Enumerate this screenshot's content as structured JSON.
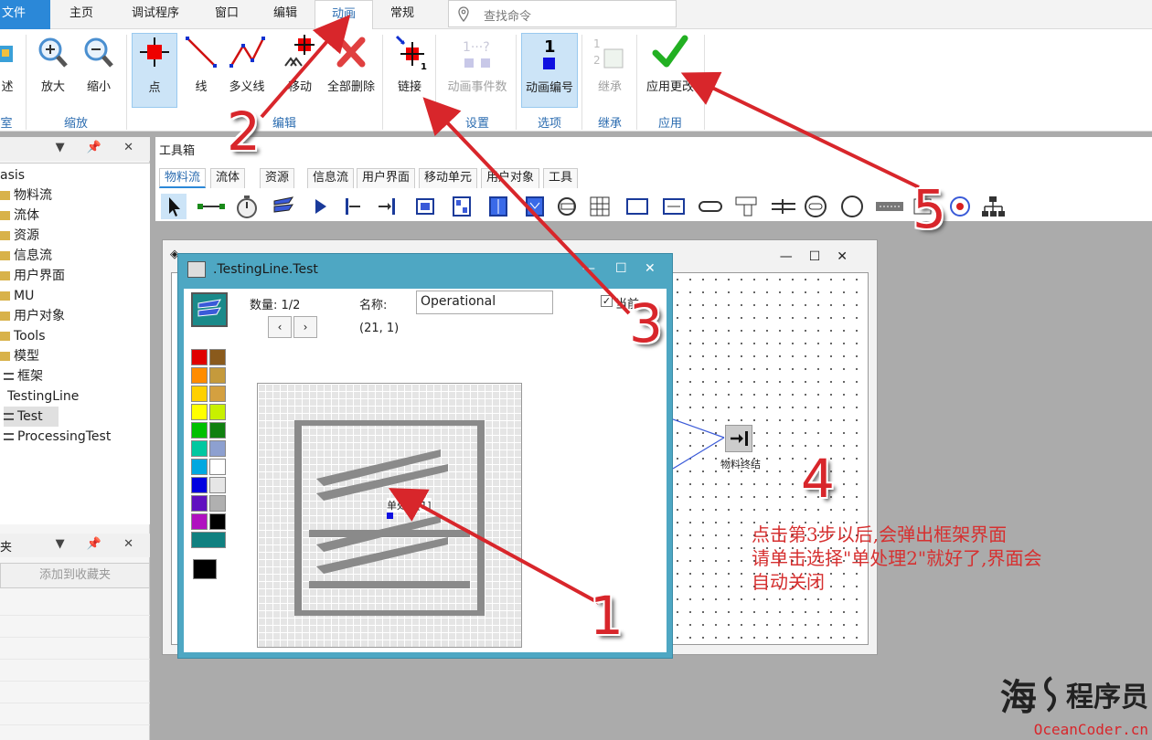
{
  "menubar": {
    "file": "文件",
    "tabs": [
      "主页",
      "调试程序",
      "窗口",
      "编辑",
      "动画",
      "常规"
    ],
    "search_placeholder": "查找命令"
  },
  "ribbon": {
    "partial_label_left": "述",
    "buttons": [
      {
        "label": "放大"
      },
      {
        "label": "缩小"
      },
      {
        "label": "点"
      },
      {
        "label": "线"
      },
      {
        "label": "多义线"
      },
      {
        "label": "移动"
      },
      {
        "label": "全部删除"
      },
      {
        "label": "链接"
      },
      {
        "label": "动画事件数"
      },
      {
        "label": "动画编号"
      },
      {
        "label": "继承"
      },
      {
        "label": "应用更改"
      }
    ],
    "groups": [
      "室",
      "缩放",
      "编辑",
      "设置",
      "选项",
      "继承",
      "应用"
    ]
  },
  "left_panel": {
    "tree": [
      "asis",
      "物料流",
      "流体",
      "资源",
      "信息流",
      "用户界面",
      "MU",
      "用户对象",
      "Tools",
      "模型",
      "框架",
      "TestingLine",
      "Test",
      "ProcessingTest"
    ],
    "fav_title": "夹",
    "fav_add": "添加到收藏夹"
  },
  "toolbox": {
    "title": "工具箱",
    "tabs": [
      "物料流",
      "流体",
      "资源",
      "信息流",
      "用户界面",
      "移动单元",
      "用户对象",
      "工具"
    ]
  },
  "dialog": {
    "title": ".TestingLine.Test",
    "count": "数量: 1/2",
    "name_label": "名称:",
    "name_value": "Operational",
    "coords": "(21, 1)",
    "checkbox_label": "当前",
    "point_label": "单处理[1]",
    "controls": {
      "minimize": "—",
      "maximize": "☐",
      "close": "✕"
    }
  },
  "frame": {
    "node_label": "物料终结"
  },
  "annotations": {
    "numbers": [
      "1",
      "2",
      "3",
      "4",
      "5"
    ],
    "note_lines": [
      "点击第3步以后,会弹出框架界面",
      "请单击选择\"单处理2\"就好了,界面会",
      "自动关闭"
    ]
  },
  "watermark": {
    "brand": "海",
    "brand_text": "程序员",
    "site": "OceanCoder.cn"
  },
  "colors": {
    "accent": "#2b88d8",
    "dialog_frame": "#4ea7c3",
    "annotation_red": "#d8262b",
    "palette": [
      "#e00000",
      "#8a5a1c",
      "#ff8c00",
      "#c59a3c",
      "#ffd000",
      "#d4a040",
      "#ffff00",
      "#c8f000",
      "#00c000",
      "#108010",
      "#00c8a0",
      "#8da0d0",
      "#00a8e0",
      "#ffffff",
      "#0000e0",
      "#e6e6e6",
      "#6010c0",
      "#b0b0b0",
      "#b010c0",
      "#000000",
      "#108080"
    ]
  }
}
